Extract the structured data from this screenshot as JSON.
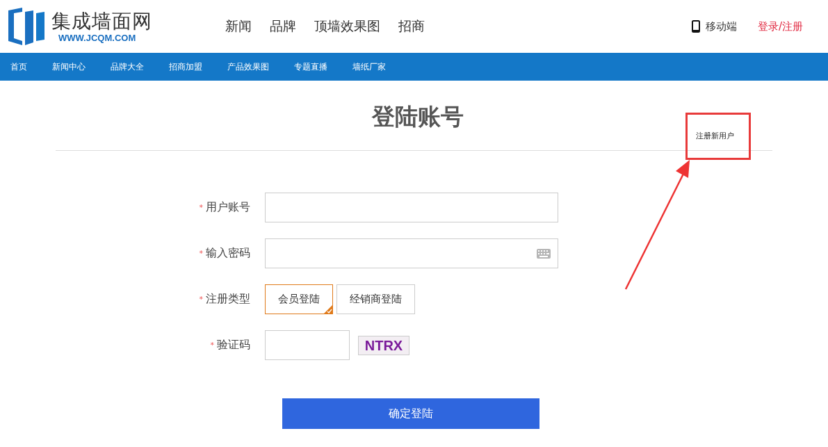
{
  "header": {
    "logo_title": "集成墙面网",
    "logo_url": "WWW.JCQM.COM",
    "menu": [
      "新闻",
      "品牌",
      "顶墙效果图",
      "招商"
    ],
    "mobile": "移动端",
    "login_link": "登录/注册"
  },
  "nav": [
    {
      "label": "首页"
    },
    {
      "label": "新闻中心"
    },
    {
      "label": "品牌大全"
    },
    {
      "label": "招商加盟"
    },
    {
      "label": "产品效果图"
    },
    {
      "label": "专题直播"
    },
    {
      "label": "墙纸厂家"
    }
  ],
  "form": {
    "title": "登陆账号",
    "register_link": "注册新用户",
    "fields": [
      {
        "kind": "text",
        "required_mark": "*",
        "label": "用户账号"
      },
      {
        "kind": "password",
        "required_mark": "*",
        "label": "输入密码"
      },
      {
        "kind": "choice",
        "required_mark": "*",
        "label": "注册类型",
        "options": [
          {
            "label": "会员登陆",
            "selected": true
          },
          {
            "label": "经销商登陆",
            "selected": false
          }
        ]
      },
      {
        "kind": "captcha",
        "required_mark": "*",
        "label": "验证码",
        "captcha": "NTRX"
      }
    ],
    "submit": "确定登陆"
  }
}
